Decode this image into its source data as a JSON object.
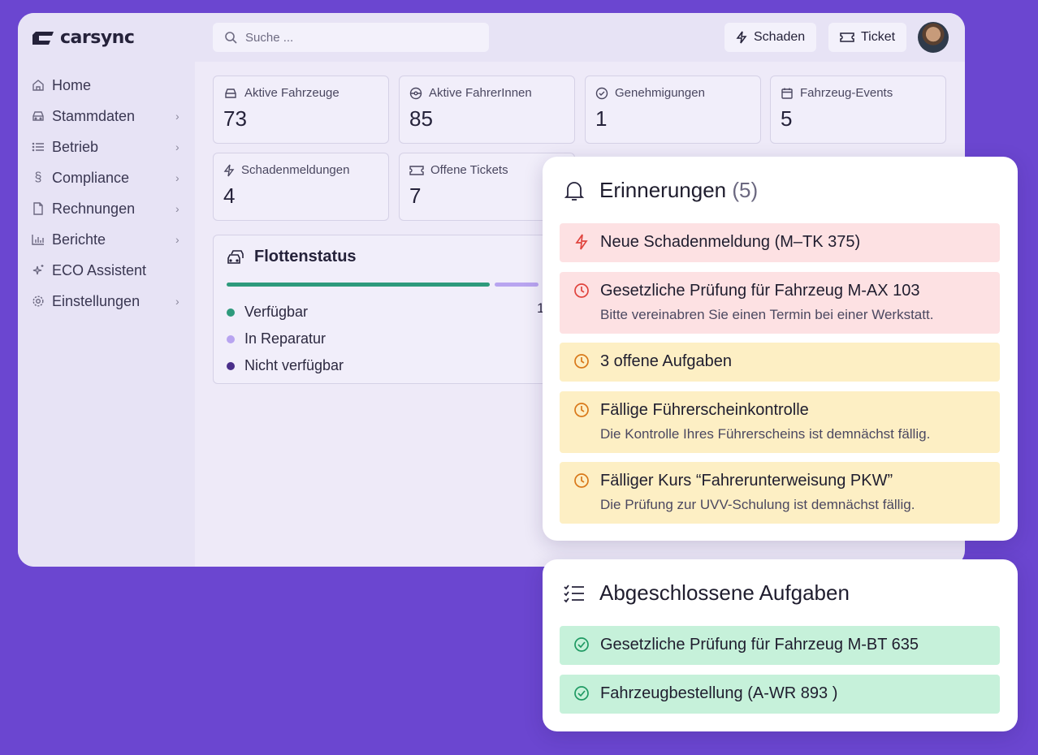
{
  "brand": {
    "name": "carsync"
  },
  "sidebar": {
    "items": [
      {
        "label": "Home",
        "icon": "home-icon",
        "chevron": false
      },
      {
        "label": "Stammdaten",
        "icon": "car-icon",
        "chevron": true
      },
      {
        "label": "Betrieb",
        "icon": "list-icon",
        "chevron": true
      },
      {
        "label": "Compliance",
        "icon": "section-icon",
        "chevron": true
      },
      {
        "label": "Rechnungen",
        "icon": "document-icon",
        "chevron": true
      },
      {
        "label": "Berichte",
        "icon": "bar-chart-icon",
        "chevron": true
      },
      {
        "label": "ECO Assistent",
        "icon": "sparkle-icon",
        "chevron": false
      },
      {
        "label": "Einstellungen",
        "icon": "gear-icon",
        "chevron": true
      }
    ]
  },
  "topbar": {
    "search_placeholder": "Suche ...",
    "schaden_label": "Schaden",
    "ticket_label": "Ticket"
  },
  "stats": [
    {
      "label": "Aktive Fahrzeuge",
      "value": "73",
      "icon": "car-icon"
    },
    {
      "label": "Aktive FahrerInnen",
      "value": "85",
      "icon": "steering-wheel-icon"
    },
    {
      "label": "Genehmigungen",
      "value": "1",
      "icon": "check-circle-icon"
    },
    {
      "label": "Fahrzeug-Events",
      "value": "5",
      "icon": "calendar-icon"
    },
    {
      "label": "Schadenmeldungen",
      "value": "4",
      "icon": "lightning-icon"
    },
    {
      "label": "Offene Tickets",
      "value": "7",
      "icon": "ticket-icon"
    }
  ],
  "fleet": {
    "title": "Flottenstatus",
    "legend": [
      {
        "label": "Verfügbar",
        "color": "#2e9a7c"
      },
      {
        "label": "In Reparatur",
        "color": "#b8a4f0"
      },
      {
        "label": "Nicht verfügbar",
        "color": "#4a2e8a"
      }
    ],
    "partial_value": "1"
  },
  "reminders": {
    "title": "Erinnerungen",
    "count": "(5)",
    "items": [
      {
        "title": "Neue Schadenmeldung (M–TK 375)",
        "subtitle": "",
        "type": "red",
        "icon": "lightning-icon"
      },
      {
        "title": "Gesetzliche Prüfung für Fahrzeug M-AX 103",
        "subtitle": "Bitte vereinabren Sie einen Termin bei einer Werkstatt.",
        "type": "red",
        "icon": "clock-icon"
      },
      {
        "title": "3 offene Aufgaben",
        "subtitle": "",
        "type": "yellow",
        "icon": "clock-icon"
      },
      {
        "title": "Fällige Führerscheinkontrolle",
        "subtitle": "Die Kontrolle Ihres Führerscheins ist demnächst fällig.",
        "type": "yellow",
        "icon": "clock-icon"
      },
      {
        "title": "Fälliger Kurs “Fahrerunterweisung PKW”",
        "subtitle": "Die Prüfung zur UVV-Schulung ist demnächst fällig.",
        "type": "yellow",
        "icon": "clock-icon"
      }
    ]
  },
  "completed": {
    "title": "Abgeschlossene Aufgaben",
    "items": [
      {
        "title": "Gesetzliche Prüfung für Fahrzeug M-BT 635",
        "icon": "check-circle-icon"
      },
      {
        "title": "Fahrzeugbestellung (A-WR 893 )",
        "icon": "check-circle-icon"
      }
    ]
  },
  "colors": {
    "background": "#6b46d0",
    "red_bg": "#fde1e3",
    "yellow_bg": "#fdefc4",
    "green_bg": "#c6f1da",
    "red_icon": "#e0443e",
    "yellow_icon": "#d9791a",
    "green_icon": "#1f9a63"
  }
}
